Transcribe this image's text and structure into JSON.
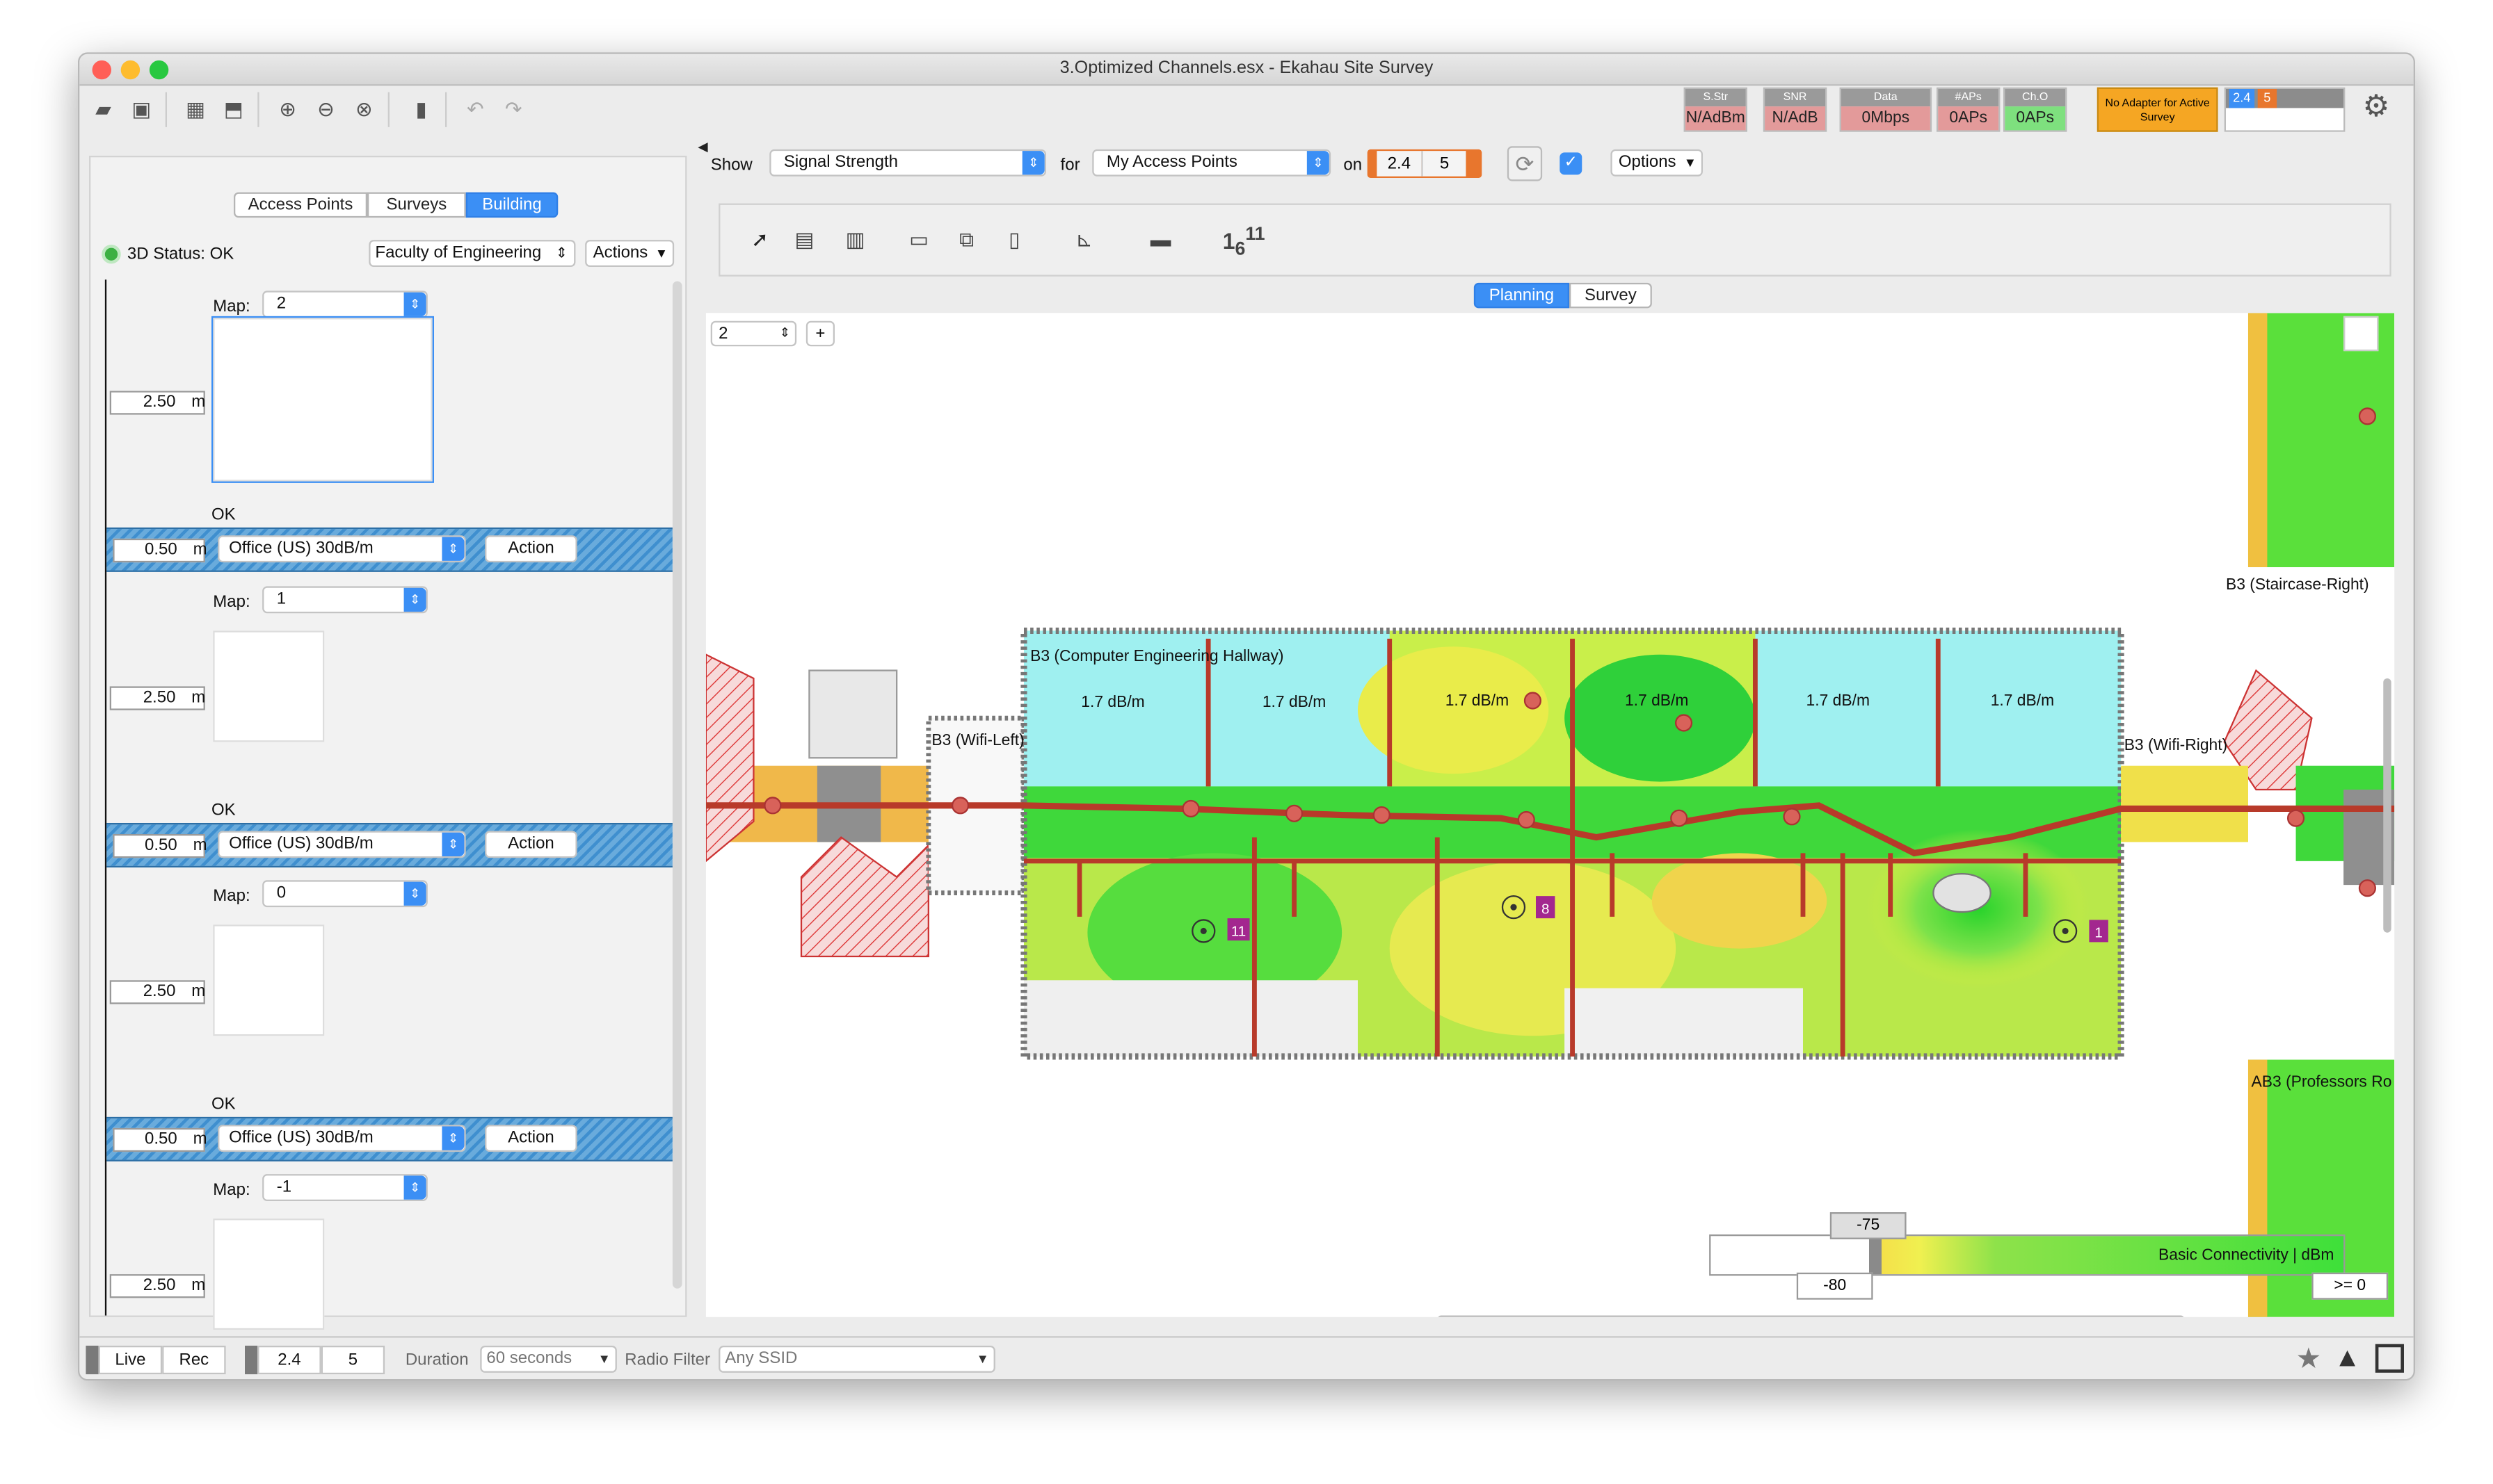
{
  "window": {
    "title": "3.Optimized Channels.esx - Ekahau Site Survey"
  },
  "indicators": [
    {
      "label": "S.Str",
      "value": "N/AdBm",
      "color": "#e39a9a"
    },
    {
      "label": "SNR",
      "value": "N/AdB",
      "color": "#e39a9a"
    },
    {
      "label": "Data",
      "value": "0Mbps",
      "color": "#e39a9a"
    },
    {
      "label": "#APs",
      "value": "0APs",
      "color": "#e39a9a"
    },
    {
      "label": "Ch.O",
      "value": "0APs",
      "color": "#7ee07e"
    }
  ],
  "adapter": {
    "text": "No Adapter for Active Survey",
    "color": "#f5a623"
  },
  "adapter_bands": [
    "2.4",
    "5"
  ],
  "left_tabs": [
    "Access Points",
    "Surveys",
    "Building"
  ],
  "left_active_tab": "Building",
  "status3d": "3D Status: OK",
  "building": {
    "selected": "Faculty of Engineering",
    "actions": "Actions"
  },
  "floors": [
    {
      "map_label": "Map:",
      "map_value": "2",
      "height": "2.50",
      "unit": "m",
      "ok": "OK",
      "slab": "0.50",
      "slab_unit": "m",
      "material": "Office (US) 30dB/m",
      "action": "Action"
    },
    {
      "map_label": "Map:",
      "map_value": "1",
      "height": "2.50",
      "unit": "m",
      "ok": "OK",
      "slab": "0.50",
      "slab_unit": "m",
      "material": "Office (US) 30dB/m",
      "action": "Action"
    },
    {
      "map_label": "Map:",
      "map_value": "0",
      "height": "2.50",
      "unit": "m",
      "ok": "OK",
      "slab": "0.50",
      "slab_unit": "m",
      "material": "Office (US) 30dB/m",
      "action": "Action"
    },
    {
      "map_label": "Map:",
      "map_value": "-1",
      "height": "2.50",
      "unit": "m",
      "ok": "",
      "slab": "",
      "slab_unit": "",
      "material": "",
      "action": ""
    }
  ],
  "show_bar": {
    "show_label": "Show",
    "show_value": "Signal Strength",
    "for_label": "for",
    "for_value": "My Access Points",
    "on_label": "on",
    "bands": [
      "2.4",
      "5"
    ],
    "options": "Options"
  },
  "mode_tabs": [
    "Planning",
    "Survey"
  ],
  "mode_active": "Planning",
  "floor_selector": "2",
  "floor_add": "+",
  "map": {
    "areas": [
      "B3 (Computer Engineering Hallway)",
      "B3 (Wifi-Left)",
      "B3 (Wifi-Right)",
      "B3 (Staircase-Right)",
      "AB3 (Professors Ro"
    ],
    "attenuation": [
      "1.7 dB/m",
      "1.7 dB/m",
      "1.7 dB/m",
      "1.7 dB/m",
      "1.7 dB/m",
      "1.7 dB/m"
    ],
    "aps": [
      "11",
      "8",
      "1"
    ]
  },
  "legend": {
    "marker": "-75",
    "min": "-80",
    "title": "Basic Connectivity | dBm",
    "max": ">= 0"
  },
  "statusbar": {
    "live": "Live",
    "rec": "Rec",
    "bands": [
      "2.4",
      "5"
    ],
    "duration_label": "Duration",
    "duration_value": "60 seconds",
    "radio_label": "Radio Filter",
    "radio_value": "Any SSID"
  }
}
